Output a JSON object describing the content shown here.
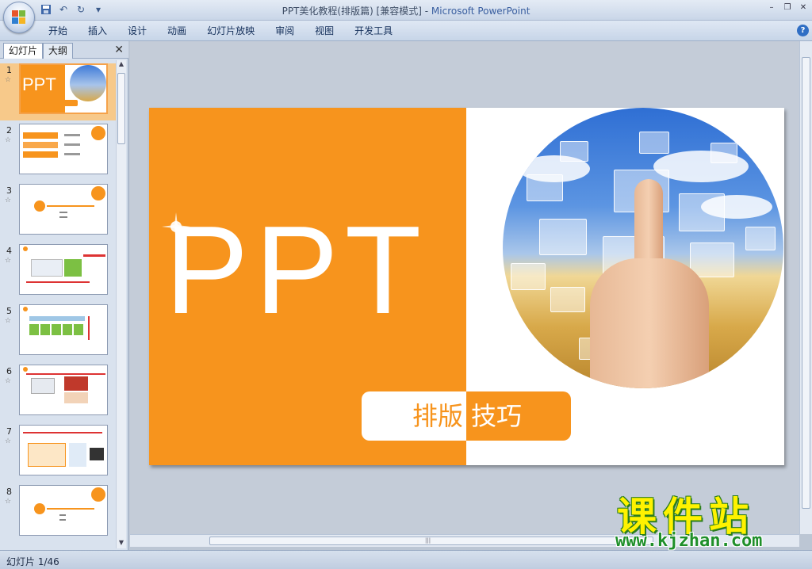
{
  "window": {
    "title_doc": "PPT美化教程(排版篇) [兼容模式]",
    "title_sep": " - ",
    "title_app": "Microsoft PowerPoint"
  },
  "ribbon": {
    "tabs": [
      "开始",
      "插入",
      "设计",
      "动画",
      "幻灯片放映",
      "审阅",
      "视图",
      "开发工具"
    ]
  },
  "panel": {
    "tab_slides": "幻灯片",
    "tab_outline": "大纲",
    "thumbnails": [
      {
        "num": "1",
        "selected": true
      },
      {
        "num": "2",
        "selected": false
      },
      {
        "num": "3",
        "selected": false
      },
      {
        "num": "4",
        "selected": false
      },
      {
        "num": "5",
        "selected": false
      },
      {
        "num": "6",
        "selected": false
      },
      {
        "num": "7",
        "selected": false
      },
      {
        "num": "8",
        "selected": false
      }
    ]
  },
  "slide": {
    "big_text": "PPT",
    "label_left": "排版",
    "label_right": "技巧",
    "accent_color": "#f7941d"
  },
  "status": {
    "slide_counter": "幻灯片 1/46"
  },
  "watermark": {
    "title": "课件站",
    "url": "www.kjzhan.com"
  }
}
